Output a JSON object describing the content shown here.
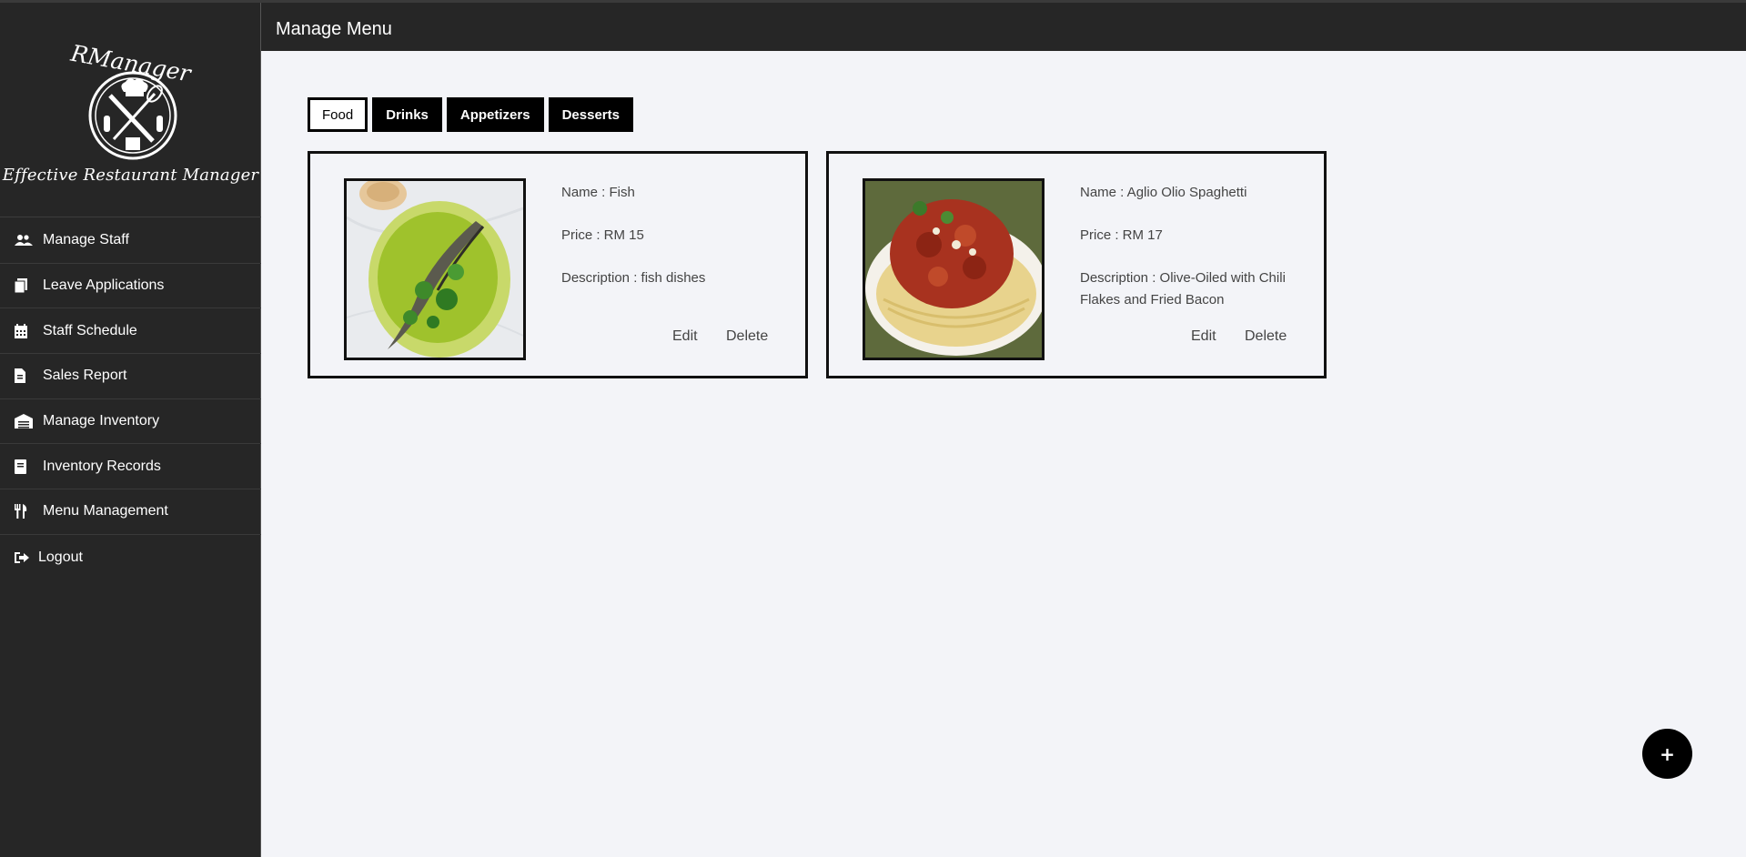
{
  "brand": {
    "name": "RManager",
    "tagline": "Effective Restaurant Manager"
  },
  "sidebar": {
    "items": [
      {
        "label": "Manage Staff",
        "icon": "users-icon"
      },
      {
        "label": "Leave Applications",
        "icon": "documents-icon"
      },
      {
        "label": "Staff Schedule",
        "icon": "calendar-icon"
      },
      {
        "label": "Sales Report",
        "icon": "report-icon"
      },
      {
        "label": "Manage Inventory",
        "icon": "warehouse-icon"
      },
      {
        "label": "Inventory Records",
        "icon": "book-icon"
      },
      {
        "label": "Menu Management",
        "icon": "utensils-icon"
      },
      {
        "label": "Logout",
        "icon": "logout-icon"
      }
    ]
  },
  "header": {
    "title": "Manage Menu"
  },
  "tabs": [
    {
      "label": "Food",
      "active": true
    },
    {
      "label": "Drinks",
      "active": false
    },
    {
      "label": "Appetizers",
      "active": false
    },
    {
      "label": "Desserts",
      "active": false
    }
  ],
  "menu_items": [
    {
      "name": "Name : Fish",
      "price": "Price : RM 15",
      "description": "Description : fish dishes",
      "edit_label": "Edit",
      "delete_label": "Delete"
    },
    {
      "name": "Name : Aglio Olio Spaghetti",
      "price": "Price : RM 17",
      "description": "Description : Olive-Oiled with Chili Flakes and Fried Bacon",
      "edit_label": "Edit",
      "delete_label": "Delete"
    }
  ],
  "fab": {
    "label": "+"
  },
  "colors": {
    "sidebar_bg": "#262626",
    "page_bg": "#f3f4f8",
    "accent": "#000000"
  }
}
